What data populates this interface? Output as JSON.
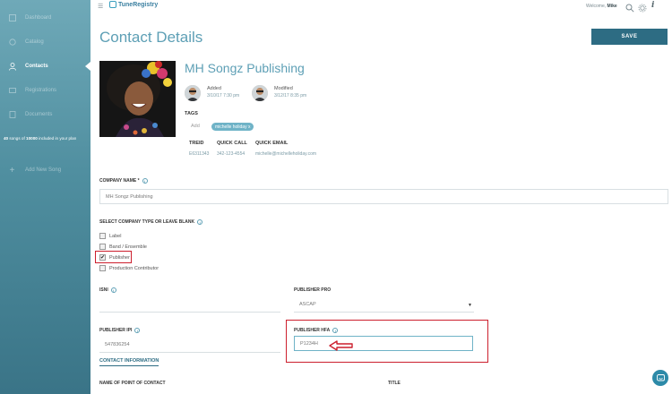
{
  "app": {
    "name": "TuneRegistry",
    "welcome_prefix": "Welcome,",
    "user": "Mike"
  },
  "sidebar": {
    "items": [
      {
        "label": "Dashboard",
        "icon": "dashboard-icon"
      },
      {
        "label": "Catalog",
        "icon": "catalog-icon"
      },
      {
        "label": "Contacts",
        "icon": "user-icon",
        "active": true
      },
      {
        "label": "Registrations",
        "icon": "registrations-icon"
      },
      {
        "label": "Documents",
        "icon": "documents-icon"
      }
    ],
    "plan_count": "40",
    "plan_mid": " songs of ",
    "plan_total": "10000",
    "plan_suffix": " included in your plan",
    "add_song": "Add New Song"
  },
  "page": {
    "title": "Contact Details",
    "save_label": "SAVE"
  },
  "contact": {
    "name": "MH Songz Publishing",
    "added_label": "Added",
    "added_value": "3/10/17 7:30 pm",
    "modified_label": "Modified",
    "modified_value": "3/12/17 8:35 pm",
    "tags_label": "TAGS",
    "tag_add": "Add",
    "tags": [
      "michelle holiday x"
    ],
    "treid_label": "TREID",
    "treid_value": "E6311343",
    "quick_call_label": "QUICK CALL",
    "quick_call_value": "342-123-4554",
    "quick_email_label": "QUICK EMAIL",
    "quick_email_value": "michelle@michelleholiday.com"
  },
  "form": {
    "company_name_label": "COMPANY NAME *",
    "company_name_value": "MH Songz Publishing",
    "company_type_label": "SELECT COMPANY TYPE OR LEAVE BLANK",
    "company_types": [
      {
        "label": "Label",
        "checked": false
      },
      {
        "label": "Band / Ensemble",
        "checked": false
      },
      {
        "label": "Publisher",
        "checked": true
      },
      {
        "label": "Production Contributor",
        "checked": false
      }
    ],
    "isni_label": "ISNI",
    "isni_value": "",
    "publisher_pro_label": "PUBLISHER PRO",
    "publisher_pro_value": "ASCAP",
    "publisher_ipi_label": "PUBLISHER IPI",
    "publisher_ipi_value": "547836254",
    "publisher_hfa_label": "PUBLISHER HFA",
    "publisher_hfa_value": "P1234H",
    "contact_info_link": "CONTACT INFORMATION",
    "point_of_contact_label": "NAME OF POINT OF CONTACT",
    "title_label": "TITLE"
  },
  "colors": {
    "accent": "#5d9fb5",
    "primary": "#2d6c83",
    "highlight": "#cc1f2d"
  }
}
